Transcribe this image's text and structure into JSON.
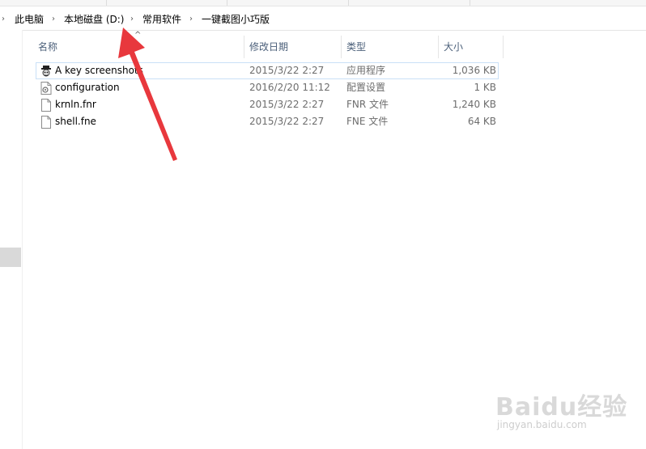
{
  "breadcrumb": {
    "items": [
      "此电脑",
      "本地磁盘 (D:)",
      "常用软件",
      "一键截图小巧版"
    ]
  },
  "columns": {
    "name": "名称",
    "date": "修改日期",
    "type": "类型",
    "size": "大小"
  },
  "files": [
    {
      "name": "A key screenshots",
      "date": "2015/3/22 2:27",
      "type": "应用程序",
      "size": "1,036 KB",
      "icon": "app-icon"
    },
    {
      "name": "configuration",
      "date": "2016/2/20 11:12",
      "type": "配置设置",
      "size": "1 KB",
      "icon": "settings-file-icon"
    },
    {
      "name": "krnln.fnr",
      "date": "2015/3/22 2:27",
      "type": "FNR 文件",
      "size": "1,240 KB",
      "icon": "file-icon"
    },
    {
      "name": "shell.fne",
      "date": "2015/3/22 2:27",
      "type": "FNE 文件",
      "size": "64 KB",
      "icon": "file-icon"
    }
  ],
  "watermark": {
    "brand": "Baidu经验",
    "url": "jingyan.baidu.com"
  },
  "colors": {
    "header_text": "#4c607a",
    "selection_border": "#c9e0f7",
    "arrow": "#e8383d"
  }
}
